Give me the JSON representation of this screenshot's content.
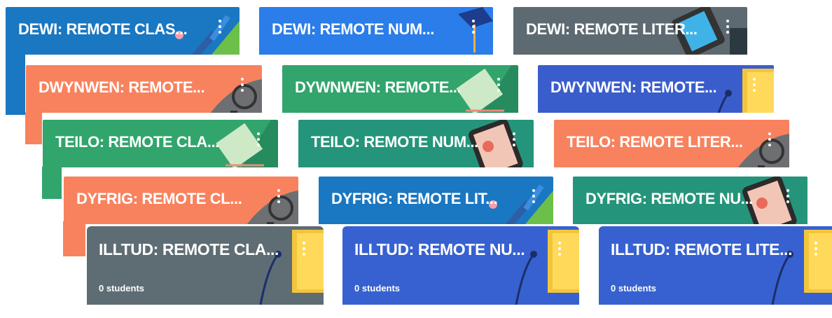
{
  "colors": {
    "blue_dark": "#1a77c2",
    "blue_bright": "#2b7de9",
    "slate": "#5d6a72",
    "salmon": "#f8825e",
    "green": "#31a56c",
    "indigo": "#3a5dcc",
    "teal": "#24957a",
    "gray_card": "#5e6d73",
    "royal": "#3761d0"
  },
  "rows": [
    {
      "cards": [
        {
          "title": "DEWI: REMOTE CLAS...",
          "theme": "blue_dark",
          "icon": "pencil-icon"
        },
        {
          "title": "DEWI: REMOTE NUM...",
          "theme": "blue_bright",
          "icon": "graduation-cap-icon"
        },
        {
          "title": "DEWI: REMOTE LITER...",
          "theme": "slate",
          "icon": "phone-icon"
        }
      ]
    },
    {
      "cards": [
        {
          "title": "DWYNWEN: REMOTE...",
          "theme": "salmon",
          "icon": "headphones-icon"
        },
        {
          "title": "DYWNWEN: REMOTE...",
          "theme": "green",
          "icon": "notebook-icon"
        },
        {
          "title": "DWYNWEN: REMOTE...",
          "theme": "indigo",
          "icon": "book-icon"
        }
      ]
    },
    {
      "cards": [
        {
          "title": "TEILO: REMOTE CLA...",
          "theme": "green",
          "icon": "notebook-icon"
        },
        {
          "title": "TEILO: REMOTE NUM...",
          "theme": "teal",
          "icon": "tablet-icon"
        },
        {
          "title": "TEILO: REMOTE LITER...",
          "theme": "salmon",
          "icon": "headphones-icon"
        }
      ]
    },
    {
      "cards": [
        {
          "title": "DYFRIG: REMOTE CL...",
          "theme": "salmon",
          "icon": "headphones-icon"
        },
        {
          "title": "DYFRIG: REMOTE LIT...",
          "theme": "blue_dark",
          "icon": "pencil-icon"
        },
        {
          "title": "DYFRIG: REMOTE NU...",
          "theme": "teal",
          "icon": "tablet-icon"
        }
      ]
    },
    {
      "cards": [
        {
          "title": "ILLTUD: REMOTE CLA...",
          "theme": "gray_card",
          "icon": "book-icon",
          "students": "0 students"
        },
        {
          "title": "ILLTUD: REMOTE NU...",
          "theme": "royal",
          "icon": "book-icon",
          "students": "0 students"
        },
        {
          "title": "ILLTUD: REMOTE LITE...",
          "theme": "royal",
          "icon": "book-icon",
          "students": "0 students"
        }
      ]
    }
  ]
}
